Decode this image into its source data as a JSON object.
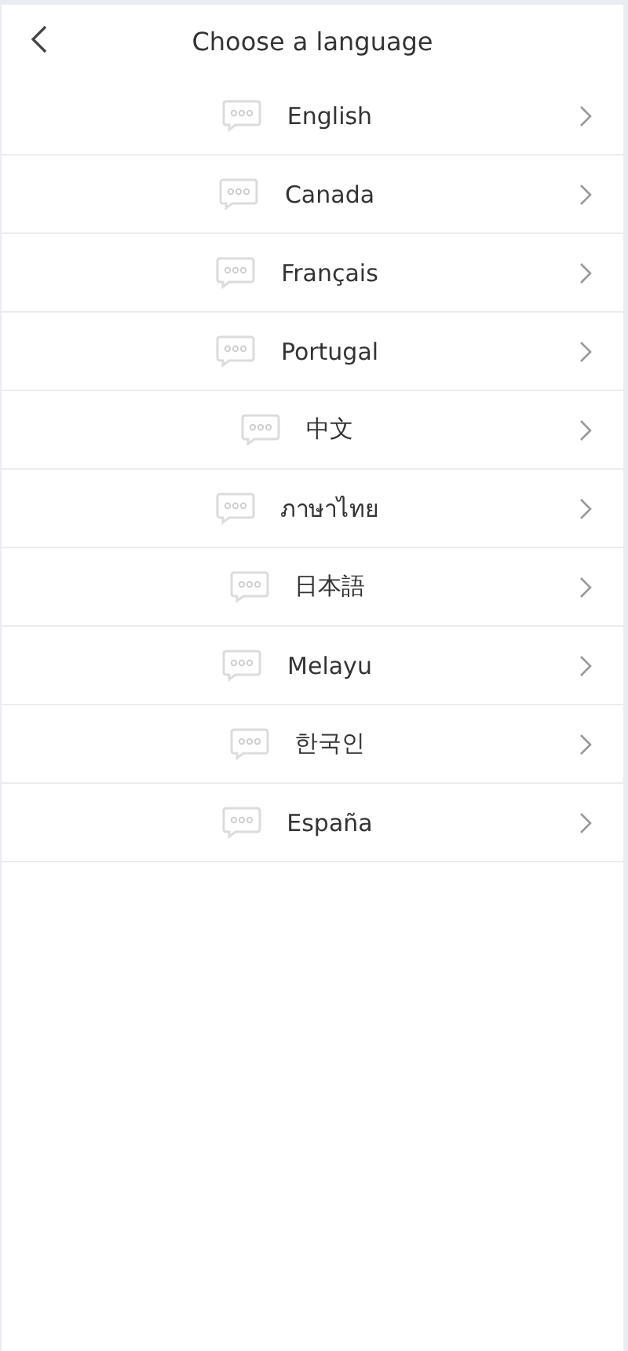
{
  "header": {
    "title": "Choose a language"
  },
  "languages": [
    {
      "label": "English"
    },
    {
      "label": "Canada"
    },
    {
      "label": "Français"
    },
    {
      "label": "Portugal"
    },
    {
      "label": "中文"
    },
    {
      "label": "ภาษาไทย"
    },
    {
      "label": "日本語"
    },
    {
      "label": "Melayu"
    },
    {
      "label": "한국인"
    },
    {
      "label": "España"
    }
  ]
}
